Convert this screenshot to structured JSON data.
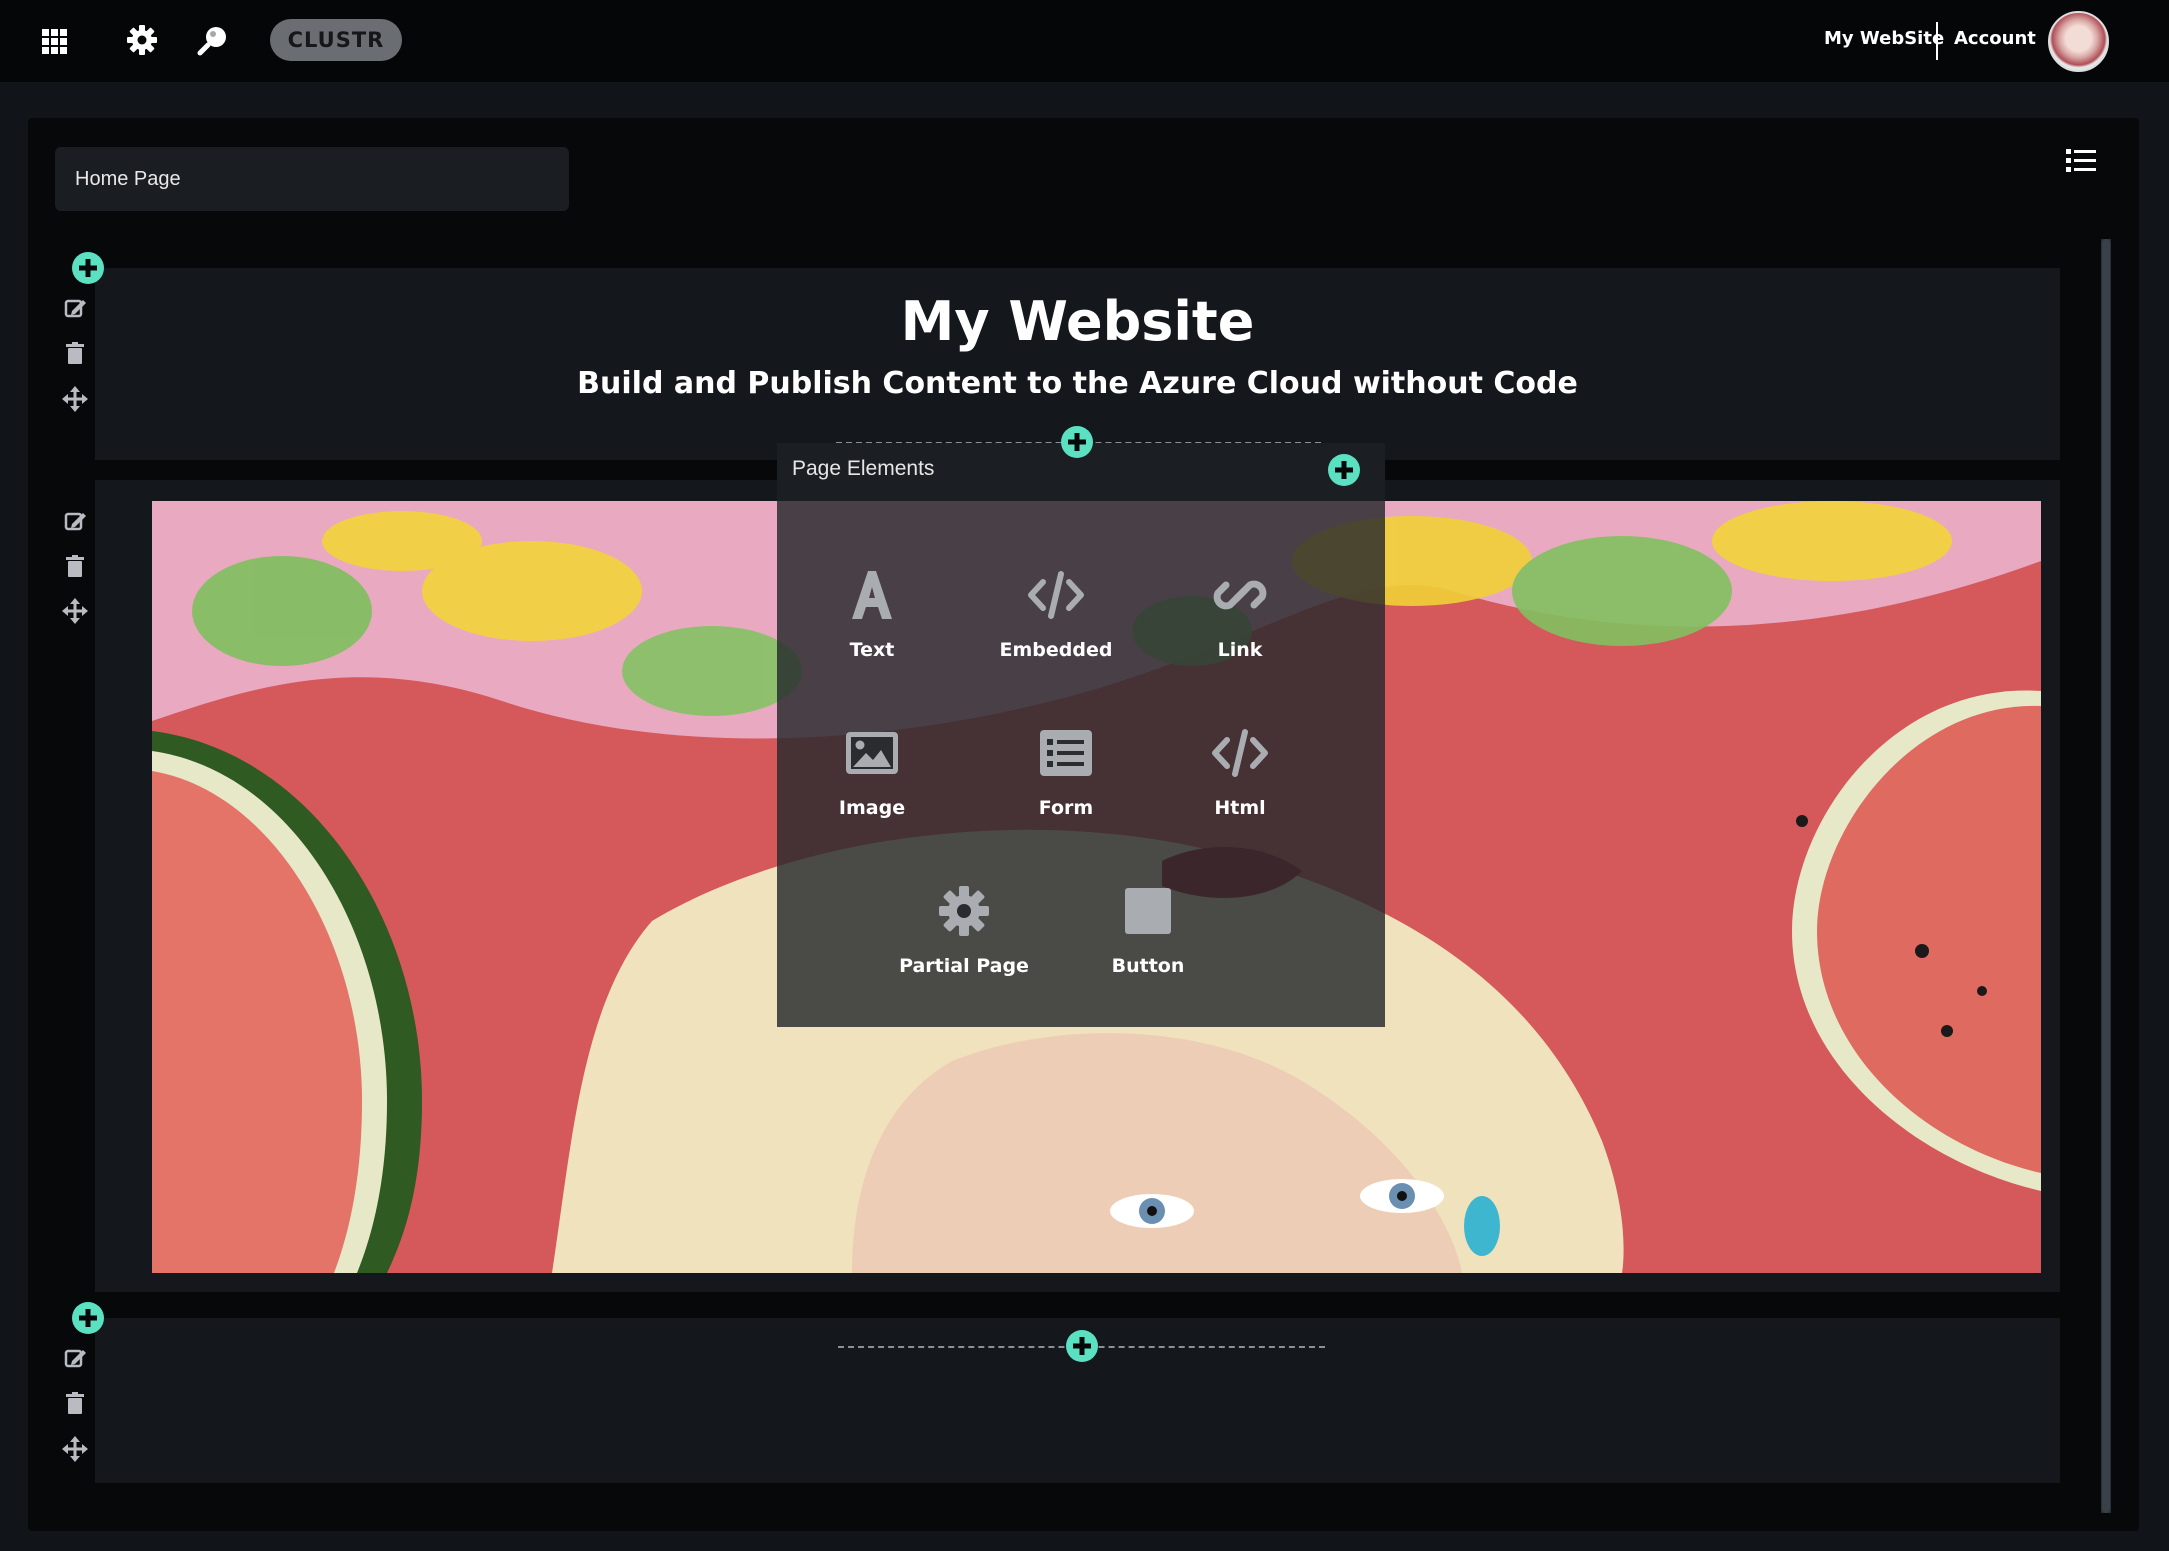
{
  "topbar": {
    "apps_icon": "grid-icon",
    "settings_icon": "gear-icon",
    "explore_icon": "search-icon",
    "brand": "CLUSTR",
    "site_link": "My WebSite",
    "account_link": "Account",
    "avatar": "user-avatar"
  },
  "editor": {
    "page_selector": "Home Page",
    "list_icon": "list-icon"
  },
  "header_section": {
    "title": "My Website",
    "subtitle": "Build and Publish Content to the Azure Cloud without Code"
  },
  "page_elements": {
    "title": "Page Elements",
    "items": [
      {
        "label": "Text",
        "icon": "text-icon"
      },
      {
        "label": "Embedded",
        "icon": "code-icon"
      },
      {
        "label": "Link",
        "icon": "link-icon"
      },
      {
        "label": "Image",
        "icon": "image-icon"
      },
      {
        "label": "Form",
        "icon": "form-icon"
      },
      {
        "label": "Html",
        "icon": "code-icon"
      },
      {
        "label": "Partial Page",
        "icon": "gear-icon"
      },
      {
        "label": "Button",
        "icon": "square-icon"
      }
    ]
  },
  "colors": {
    "accent": "#5ce0c2",
    "background": "#111418",
    "panel": "#06080a",
    "section": "#14181c"
  }
}
